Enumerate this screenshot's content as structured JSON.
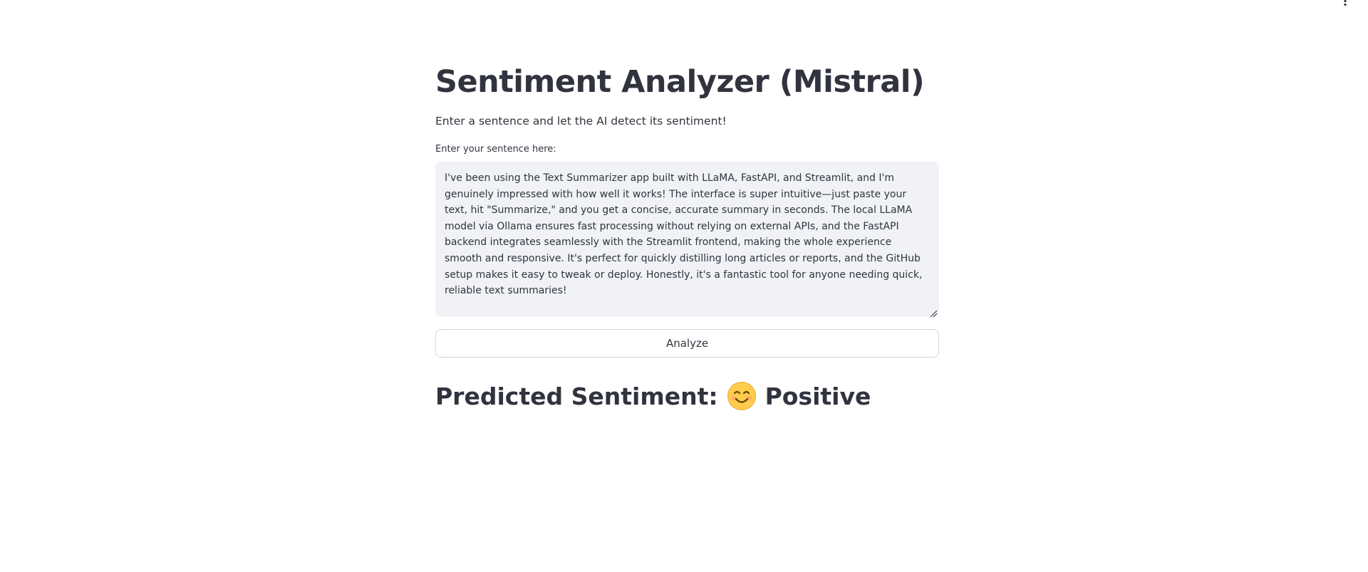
{
  "app": {
    "title": "Sentiment Analyzer (Mistral)",
    "subtitle": "Enter a sentence and let the AI detect its sentiment!"
  },
  "input": {
    "label": "Enter your sentence here:",
    "value": "I've been using the Text Summarizer app built with LLaMA, FastAPI, and Streamlit, and I'm genuinely impressed with how well it works! The interface is super intuitive—just paste your text, hit \"Summarize,\" and you get a concise, accurate summary in seconds. The local LLaMA model via Ollama ensures fast processing without relying on external APIs, and the FastAPI backend integrates seamlessly with the Streamlit frontend, making the whole experience smooth and responsive. It's perfect for quickly distilling long articles or reports, and the GitHub setup makes it easy to tweak or deploy. Honestly, it's a fantastic tool for anyone needing quick, reliable text summaries!"
  },
  "actions": {
    "analyze_label": "Analyze"
  },
  "result": {
    "prefix": "Predicted Sentiment:",
    "emoji_icon": "smiling-face-icon",
    "sentiment": "Positive"
  },
  "header": {
    "menu_icon": "vertical-ellipsis-icon"
  },
  "colors": {
    "text": "#31333f",
    "input_background": "#f0f2f6",
    "button_border": "#d6d6d9",
    "emoji_fill": "#ffcc4d"
  }
}
